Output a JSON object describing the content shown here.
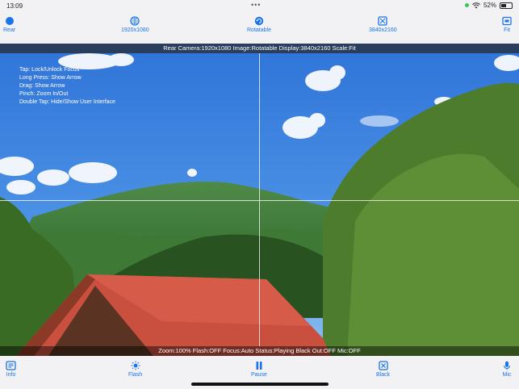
{
  "status_bar": {
    "time": "13:09",
    "battery": "52%",
    "battery_level": 0.52
  },
  "top_toolbar": {
    "rear": "Rear",
    "resolution": "1920x1080",
    "rotatable": "Rotatable",
    "display": "3840x2160",
    "fit": "Fit"
  },
  "info_bar": "Rear Camera:1920x1080  Image:Rotatable  Display:3840x2160  Scale:Fit",
  "help_lines": [
    "Tap: Lock/Unlock Focus",
    "Long Press: Show Arrow",
    "Drag: Show Arrow",
    "Pinch: Zoom In/Out",
    "Double Tap: Hide/Show User Interface"
  ],
  "status_line": "Zoom:100% Flash:OFF Focus:Auto Status:Playing Black Out:OFF Mic:OFF",
  "bottom_toolbar": {
    "info": "Info",
    "flash": "Flash",
    "pause": "Pause",
    "black": "Black",
    "mic": "Mic"
  },
  "colors": {
    "accent": "#1a73e8",
    "toolbar_bg": "#f2f2f4"
  },
  "icons": {
    "rear": "circle-icon",
    "resolution": "grid-circle-icon",
    "rotatable": "rotate-icon",
    "display": "display-icon",
    "fit": "fit-icon",
    "info": "info-icon",
    "flash": "sun-icon",
    "pause": "pause-icon",
    "black": "black-icon",
    "mic": "mic-icon"
  }
}
